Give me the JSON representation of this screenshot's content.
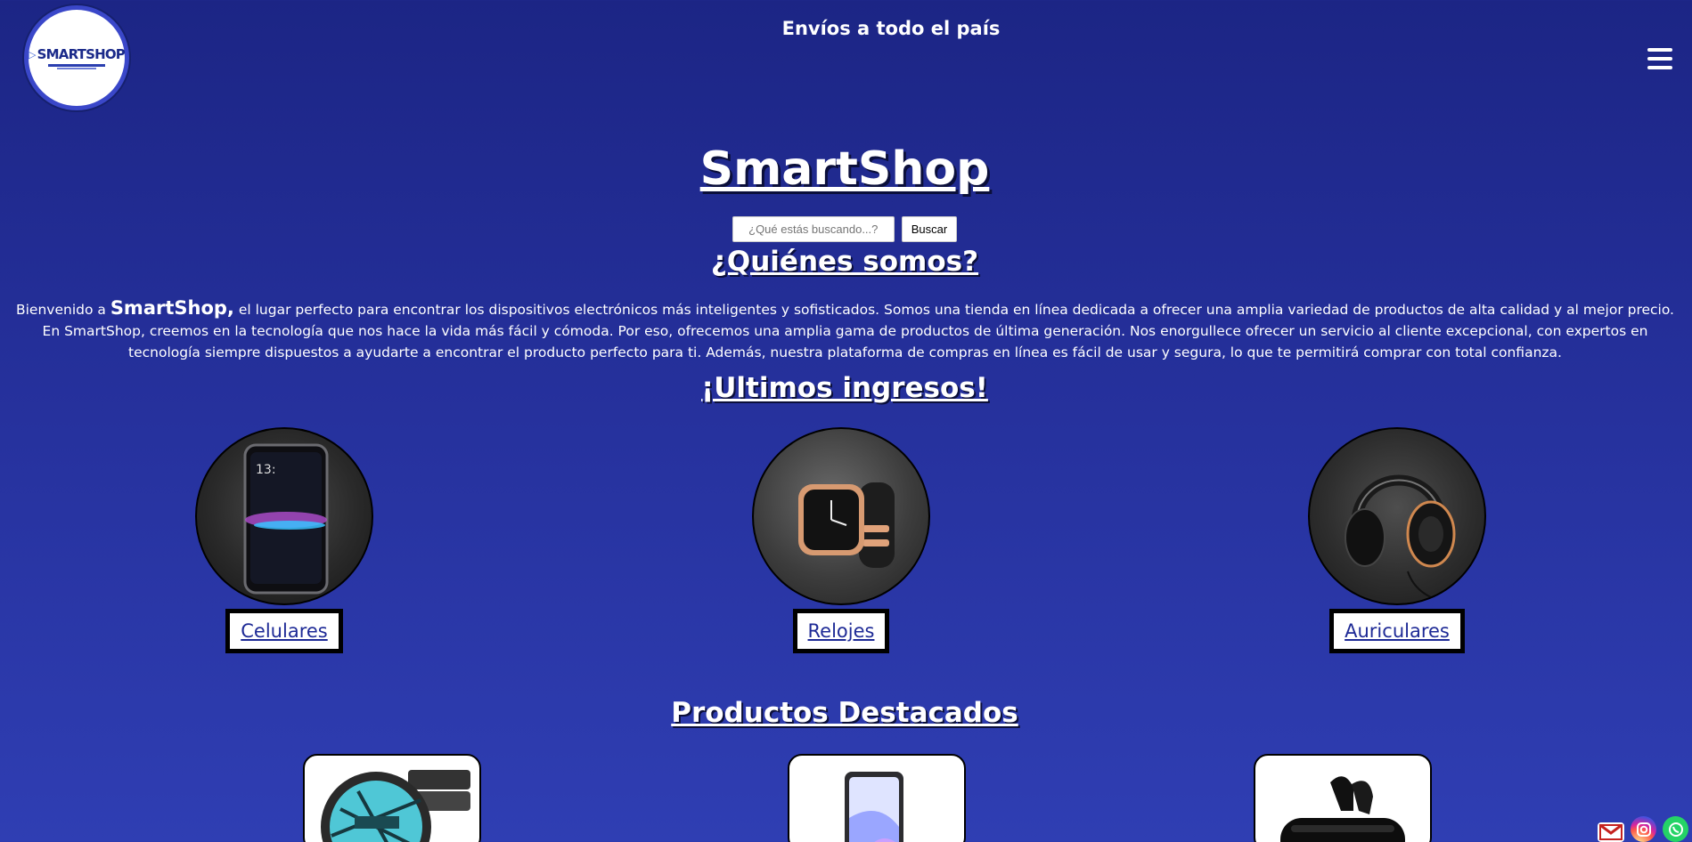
{
  "logo": {
    "text": "SMARTSHOP"
  },
  "topbar": {
    "shipping": "Envíos a todo el país"
  },
  "menu": {
    "icon": "hamburger-menu-icon"
  },
  "hero": {
    "title": "SmartShop"
  },
  "search": {
    "placeholder": "¿Qué estás buscando...?",
    "button": "Buscar"
  },
  "about": {
    "heading": "¿Quiénes somos?",
    "intro": "Bienvenido a ",
    "brand": "SmartShop,",
    "body": " el lugar perfecto para encontrar los dispositivos electrónicos más inteligentes y sofisticados. Somos una tienda en línea dedicada a ofrecer una amplia variedad de productos de alta calidad y al mejor precio. En SmartShop, creemos en la tecnología que nos hace la vida más fácil y cómoda. Por eso, ofrecemos una amplia gama de productos de última generación. Nos enorgullece ofrecer un servicio al cliente excepcional, con expertos en tecnología siempre dispuestos a ayudarte a encontrar el producto perfecto para ti. Además, nuestra plataforma de compras en línea es fácil de usar y segura, lo que te permitirá comprar con total confianza."
  },
  "latest": {
    "heading": "¡Ultimos ingresos!",
    "categories": [
      {
        "label": "Celulares",
        "icon": "smartphone-image"
      },
      {
        "label": "Relojes",
        "icon": "smartwatch-image"
      },
      {
        "label": "Auriculares",
        "icon": "headphones-image"
      }
    ]
  },
  "featured": {
    "heading": "Productos Destacados",
    "products": [
      {
        "icon": "smartwatch-product-image"
      },
      {
        "icon": "smartphone-product-image"
      },
      {
        "icon": "earbuds-product-image"
      }
    ]
  },
  "social": {
    "items": [
      {
        "icon": "gmail-icon",
        "color": "#c5221f"
      },
      {
        "icon": "instagram-icon",
        "color": "#d6249f"
      },
      {
        "icon": "whatsapp-icon",
        "color": "#25d366"
      }
    ]
  }
}
